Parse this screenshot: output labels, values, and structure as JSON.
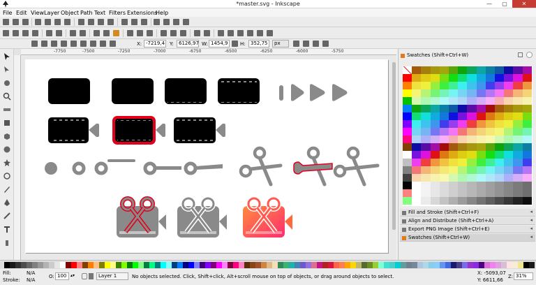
{
  "window": {
    "title": "*master.svg - Inkscape",
    "min_label": "—",
    "max_label": "▢",
    "close_label": "✕"
  },
  "menu": [
    "File",
    "Edit",
    "View",
    "Layer",
    "Object",
    "Path",
    "Text",
    "Filters",
    "Extensions",
    "Help"
  ],
  "controls": {
    "x_label": "X:",
    "x_value": "-7219,4",
    "y_label": "Y:",
    "y_value": "6126,97",
    "w_label": "W:",
    "w_value": "1454,9",
    "h_label": "H:",
    "h_value": "352,75",
    "unit": "px"
  },
  "ruler": {
    "ticks": [
      "-7750",
      "-7500",
      "-7250",
      "-7000",
      "-6750",
      "-6500",
      "-6250",
      "-6000",
      "-5750"
    ]
  },
  "dock": {
    "swatches_title": "Swatches (Shift+Ctrl+W)",
    "tabs": [
      "Fill and Stroke (Shift+Ctrl+F)",
      "Align and Distribute (Shift+Ctrl+A)",
      "Export PNG Image (Shift+Ctrl+E)",
      "Swatches (Shift+Ctrl+W)"
    ]
  },
  "status": {
    "fill_label": "Fill:",
    "fill_value": "N/A",
    "stroke_label": "Stroke:",
    "stroke_value": "N/A",
    "opacity_label": "O:",
    "opacity_value": "100",
    "layer": "Layer 1",
    "message": "No objects selected. Click, Shift+click, Alt+scroll mouse on top of objects, or drag around objects to select.",
    "x_coord": "X: -5093,07",
    "y_coord": "Y: 6611,66",
    "zoom_label": "Z:",
    "zoom": "31%"
  },
  "colors": {
    "accent_red": "#e2001a",
    "icon_gray": "#7a7a7a",
    "gradient_start": "#ff6a3d",
    "gradient_end": "#ff2d6f"
  }
}
